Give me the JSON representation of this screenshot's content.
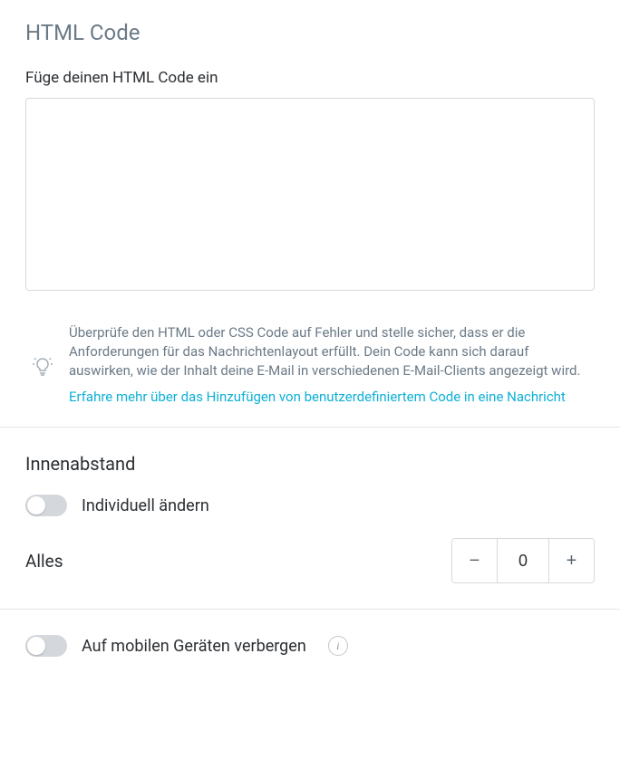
{
  "header": {
    "title": "HTML Code"
  },
  "codeField": {
    "label": "Füge deinen HTML Code ein",
    "value": ""
  },
  "help": {
    "text": "Überprüfe den HTML oder CSS Code auf Fehler und stelle sicher, dass er die Anforderungen für das Nachrichtenlayout erfüllt. Dein Code kann sich darauf auswirken, wie der Inhalt deine E-Mail in verschiedenen E-Mail-Clients angezeigt wird.",
    "linkText": "Erfahre mehr über das Hinzufügen von benutzerdefiniertem Code in eine Nachricht"
  },
  "padding": {
    "heading": "Innenabstand",
    "toggleLabel": "Individuell ändern",
    "allLabel": "Alles",
    "allValue": "0"
  },
  "mobile": {
    "toggleLabel": "Auf mobilen Geräten verbergen"
  }
}
